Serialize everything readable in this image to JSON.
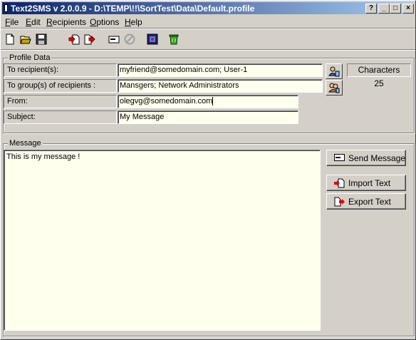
{
  "window": {
    "title": "Text2SMS v 2.0.0.9 - D:\\TEMP\\!!\\SortTest\\Data\\Default.profile",
    "help_btn": "?",
    "minimize_btn": "_",
    "maximize_btn": "□",
    "close_btn": "×"
  },
  "menu": {
    "items": [
      {
        "accel": "F",
        "rest": "ile"
      },
      {
        "accel": "E",
        "rest": "dit"
      },
      {
        "accel": "R",
        "rest": "ecipients"
      },
      {
        "accel": "O",
        "rest": "ptions"
      },
      {
        "accel": "H",
        "rest": "elp"
      }
    ]
  },
  "toolbar": {
    "icons": [
      "new-file-icon",
      "open-folder-icon",
      "save-disk-icon",
      "import-icon",
      "export-icon",
      "send-envelope-icon",
      "cancel-icon",
      "settings-film-icon",
      "recycle-bin-icon"
    ]
  },
  "profile": {
    "group_label": "Profile Data",
    "to_label": "To recipient(s):",
    "to_value": "myfriend@somedomain.com; User-1",
    "group_recipients_label": "To group(s) of recipients :",
    "group_recipients_value": "Mansgers; Network Administrators",
    "from_label": "From:",
    "from_value": "olegvg@somedomain.com",
    "subject_label": "Subject:",
    "subject_value": "My Message",
    "characters_label": "Characters",
    "characters_count": "25"
  },
  "message": {
    "group_label": "Message",
    "text": "This is my message !",
    "send_label": "Send Message",
    "import_label": "Import Text",
    "export_label": "Export Text"
  },
  "colors": {
    "titlebar_start": "#0a246a",
    "titlebar_end": "#a6caf0",
    "input_bg": "#ffffee",
    "window_bg": "#d4d0c8"
  }
}
